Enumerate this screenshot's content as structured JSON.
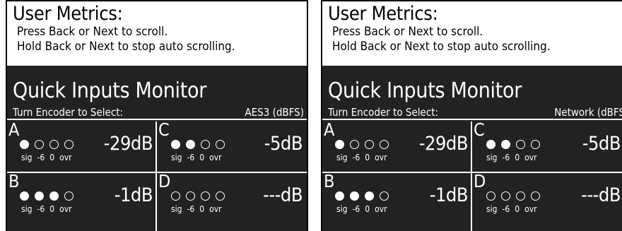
{
  "screens": [
    {
      "header": {
        "title": "User Metrics:",
        "line1": "Press Back or Next to scroll.",
        "line2": "Hold Back or Next to stop auto scrolling."
      },
      "monitor": {
        "title": "Quick Inputs Monitor",
        "instruction": "Turn Encoder to Select:",
        "source": "AES3 (dBFS)"
      },
      "channels": [
        {
          "letter": "A",
          "level": "-29dB",
          "lit": 1,
          "scale": [
            "sig",
            "-6",
            "0",
            "ovr"
          ]
        },
        {
          "letter": "C",
          "level": "-5dB",
          "lit": 2,
          "scale": [
            "sig",
            "-6",
            "0",
            "ovr"
          ]
        },
        {
          "letter": "B",
          "level": "-1dB",
          "lit": 3,
          "scale": [
            "sig",
            "-6",
            "0",
            "ovr"
          ]
        },
        {
          "letter": "D",
          "level": "---dB",
          "lit": 0,
          "scale": [
            "sig",
            "-6",
            "0",
            "ovr"
          ]
        }
      ]
    },
    {
      "header": {
        "title": "User Metrics:",
        "line1": "Press Back or Next to scroll.",
        "line2": "Hold Back or Next to stop auto scrolling."
      },
      "monitor": {
        "title": "Quick Inputs Monitor",
        "instruction": "Turn Encoder to Select:",
        "source": "Network (dBFS"
      },
      "channels": [
        {
          "letter": "A",
          "level": "-29dB",
          "lit": 1,
          "scale": [
            "sig",
            "-6",
            "0",
            "ovr"
          ]
        },
        {
          "letter": "C",
          "level": "-5dB",
          "lit": 2,
          "scale": [
            "sig",
            "-6",
            "0",
            "ovr"
          ]
        },
        {
          "letter": "B",
          "level": "-1dB",
          "lit": 3,
          "scale": [
            "sig",
            "-6",
            "0",
            "ovr"
          ]
        },
        {
          "letter": "D",
          "level": "---dB",
          "lit": 0,
          "scale": [
            "sig",
            "-6",
            "0",
            "ovr"
          ]
        }
      ]
    }
  ]
}
